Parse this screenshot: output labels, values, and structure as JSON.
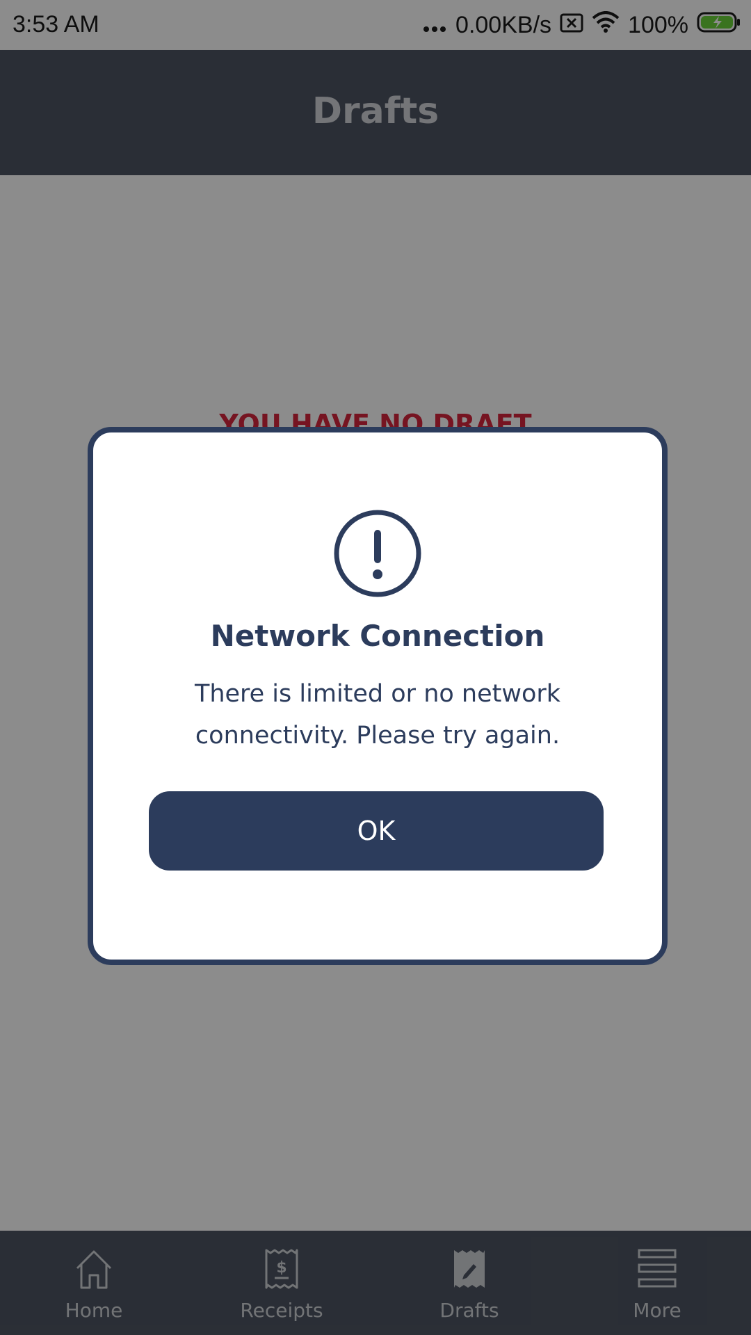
{
  "status_bar": {
    "time": "3:53  AM",
    "net_speed": "0.00KB/s",
    "battery": "100%",
    "icons": [
      "signal-dots-icon",
      "sim-off-icon",
      "wifi-icon",
      "battery-charging-icon"
    ]
  },
  "header": {
    "title": "Drafts"
  },
  "main": {
    "empty_title": "YOU HAVE NO DRAFT",
    "empty_text": ""
  },
  "bottom_nav": {
    "items": [
      {
        "label": "Home",
        "icon": "home-icon",
        "active": false
      },
      {
        "label": "Receipts",
        "icon": "receipt-icon",
        "active": false
      },
      {
        "label": "Drafts",
        "icon": "draft-edit-icon",
        "active": true
      },
      {
        "label": "More",
        "icon": "menu-icon",
        "active": false
      }
    ]
  },
  "dialog": {
    "icon": "exclamation-circle-icon",
    "title": "Network Connection",
    "message": "There is limited or no network connectivity. Please try again.",
    "ok_label": "OK"
  },
  "colors": {
    "header_bg": "#4e5563",
    "dialog_accent": "#2c3c5c",
    "empty_title": "#d7263d"
  }
}
